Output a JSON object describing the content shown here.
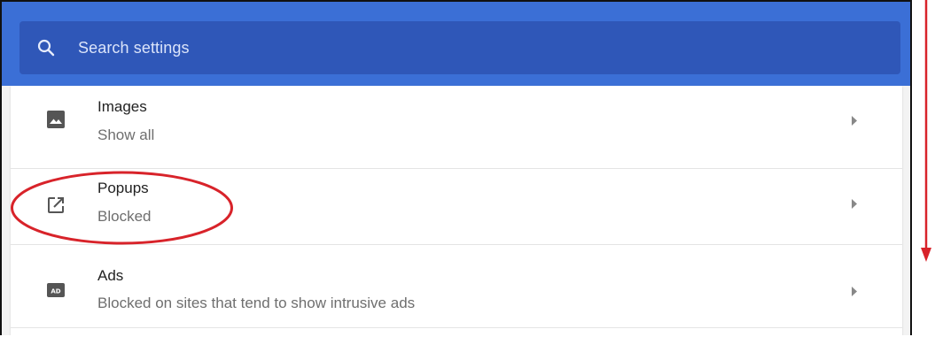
{
  "search": {
    "placeholder": "Search settings",
    "icon": "search-icon"
  },
  "settings": {
    "items": [
      {
        "title": "Images",
        "subtitle": "Show all",
        "icon": "image-icon"
      },
      {
        "title": "Popups",
        "subtitle": "Blocked",
        "icon": "open-in-new-icon"
      },
      {
        "title": "Ads",
        "subtitle": "Blocked on sites that tend to show intrusive ads",
        "icon": "ads-icon"
      }
    ]
  },
  "colors": {
    "header": "#3b6fd6",
    "search_bar": "#2f57b8",
    "annotation": "#d8232a"
  }
}
